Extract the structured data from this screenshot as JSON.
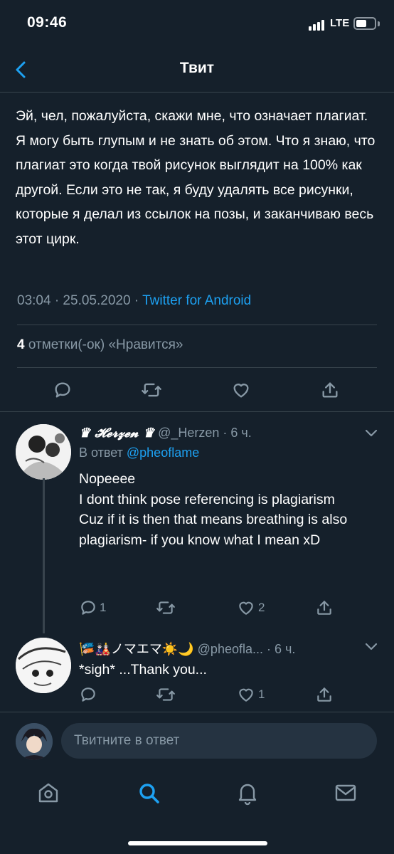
{
  "status_bar": {
    "time": "09:46",
    "network": "LTE"
  },
  "nav": {
    "title": "Твит"
  },
  "tweet": {
    "text": "Эй, чел, пожалуйста, скажи мне, что означает плагиат. Я могу быть глупым и не знать об этом. Что я знаю, что плагиат это когда твой рисунок выглядит на 100% как другой. Если это не так, я буду удалять все рисунки, которые я делал из ссылок на позы, и заканчиваю весь этот цирк.",
    "time_date": "03:04 · 25.05.2020 · ",
    "source": "Twitter for Android",
    "likes_count": "4",
    "likes_label": " отметки(-ок) «Нравится»"
  },
  "replies": [
    {
      "display_name": "♛ 𝓗𝓮𝓻𝔃𝓮𝓷 ♛",
      "handle_time": " @_Herzen · 6 ч.",
      "reply_to_prefix": "В ответ ",
      "reply_to_handle": "@pheoflame",
      "text": "Nopeeee\nI dont think pose referencing is plagiarism\nCuz if it is then that means breathing is also plagiarism- if you know what I mean xD",
      "reply_count": "1",
      "retweet_count": "",
      "like_count": "2"
    },
    {
      "display_name": "🎏🎎ノマエマ☀️🌙",
      "handle_time": " @pheofla... · 6 ч.",
      "text": "*sigh* ...Thank you...",
      "reply_count": "",
      "retweet_count": "",
      "like_count": "1"
    }
  ],
  "compose": {
    "placeholder": "Твитните в ответ"
  },
  "tabs": [
    "home-icon",
    "search-icon",
    "notifications-icon",
    "messages-icon"
  ],
  "colors": {
    "background": "#15202b",
    "accent": "#1da1f2",
    "secondary_text": "#8899a6",
    "divider": "#38444d"
  }
}
